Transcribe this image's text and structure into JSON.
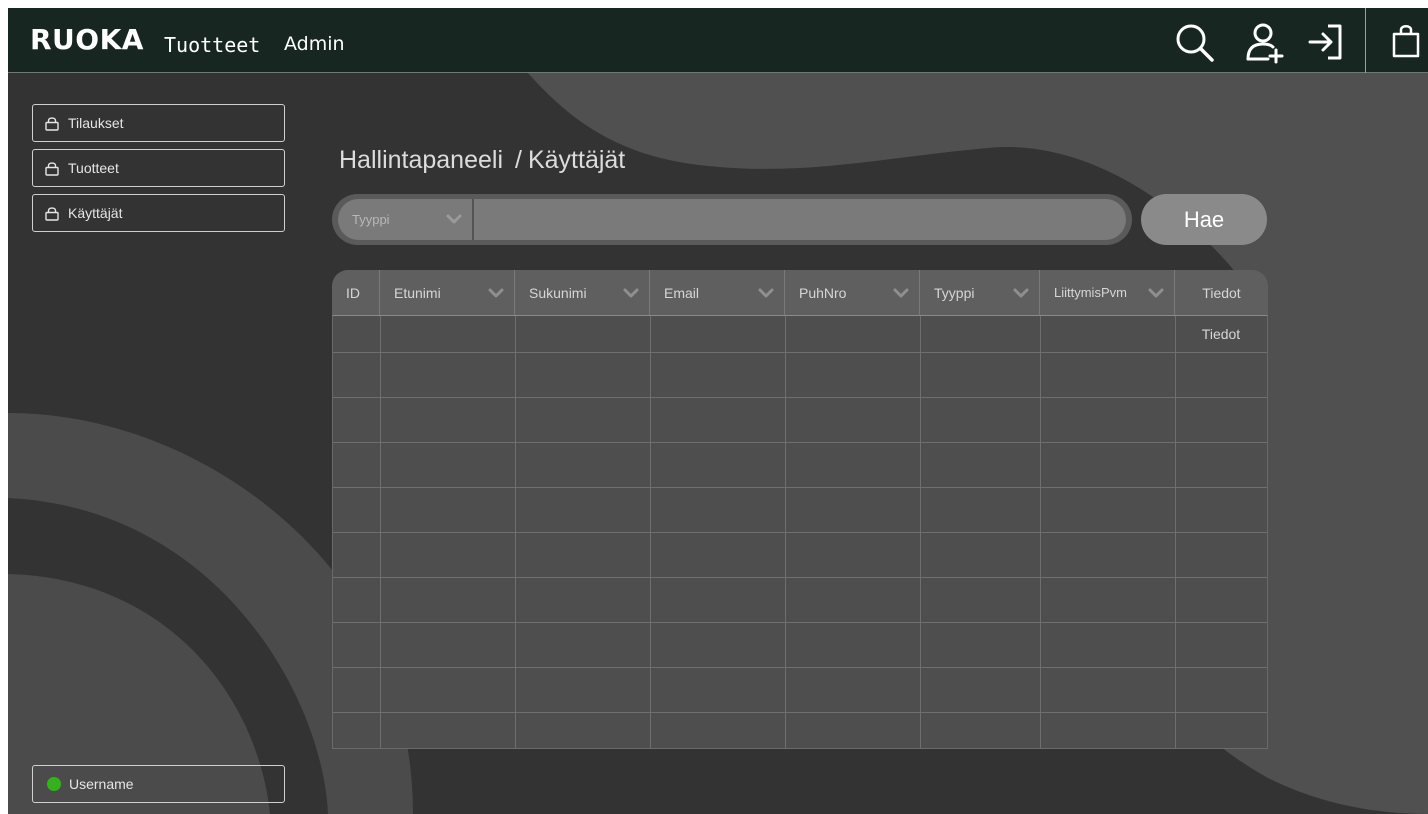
{
  "header": {
    "logo": "RUOKA",
    "nav_products": "Tuotteet",
    "nav_admin": "Admin",
    "icons": [
      "search-icon",
      "add-user-icon",
      "login-icon",
      "shopping-bag-icon"
    ]
  },
  "sidebar": {
    "items": [
      {
        "label": "Tilaukset",
        "icon": "lock-icon"
      },
      {
        "label": "Tuotteet",
        "icon": "lock-icon"
      },
      {
        "label": "Käyttäjät",
        "icon": "lock-icon"
      }
    ],
    "user": {
      "label": "Username",
      "status_color": "#33b21c"
    }
  },
  "main": {
    "breadcrumb": {
      "root": "Hallintapaneeli",
      "separator": "/",
      "current": "Käyttäjät"
    },
    "search": {
      "type_label": "Tyyppi",
      "value": "",
      "placeholder": "",
      "button_label": "Hae"
    },
    "table": {
      "columns": [
        {
          "label": "ID",
          "sortable": false
        },
        {
          "label": "Etunimi",
          "sortable": true
        },
        {
          "label": "Sukunimi",
          "sortable": true
        },
        {
          "label": "Email",
          "sortable": true
        },
        {
          "label": "PuhNro",
          "sortable": true
        },
        {
          "label": "Tyyppi",
          "sortable": true
        },
        {
          "label": "LiittymisPvm",
          "sortable": true
        },
        {
          "label": "Tiedot",
          "sortable": false
        }
      ],
      "rows": [
        {
          "id": "",
          "etunimi": "",
          "sukunimi": "",
          "email": "",
          "puhnro": "",
          "tyyppi": "",
          "liittymispvm": "",
          "tiedot": "Tiedot"
        }
      ]
    }
  },
  "colors": {
    "header_bg": "#182621",
    "page_bg": "#333333",
    "panel_bg": "#4e4e4e",
    "status_online": "#33b21c"
  }
}
